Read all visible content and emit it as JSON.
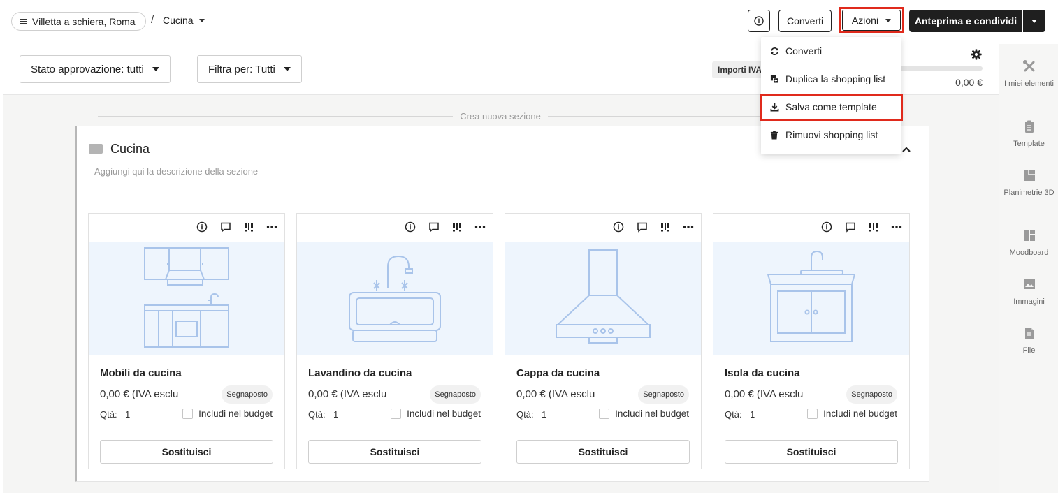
{
  "header": {
    "project": "Villetta a schiera, Roma",
    "separator": "/",
    "room": "Cucina",
    "convert_label": "Converti",
    "actions_label": "Azioni",
    "preview_label": "Anteprima e condividi"
  },
  "filters": {
    "approval": "Stato approvazione: tutti",
    "filter_by": "Filtra per: Tutti",
    "amounts_chip": "Importi IVA",
    "total": "0,00 €"
  },
  "section": {
    "new_section": "Crea nuova sezione",
    "title": "Cucina",
    "description": "Aggiungi qui la descrizione della sezione"
  },
  "products": [
    {
      "name": "Mobili da cucina",
      "price": "0,00 € (IVA esclu",
      "badge": "Segnaposto",
      "qty_label": "Qtà:",
      "qty": "1",
      "budget_label": "Includi nel budget",
      "replace_label": "Sostituisci",
      "icon": "kitchen-furniture-illustration"
    },
    {
      "name": "Lavandino da cucina",
      "price": "0,00 € (IVA esclu",
      "badge": "Segnaposto",
      "qty_label": "Qtà:",
      "qty": "1",
      "budget_label": "Includi nel budget",
      "replace_label": "Sostituisci",
      "icon": "kitchen-sink-illustration"
    },
    {
      "name": "Cappa da cucina",
      "price": "0,00 € (IVA esclu",
      "badge": "Segnaposto",
      "qty_label": "Qtà:",
      "qty": "1",
      "budget_label": "Includi nel budget",
      "replace_label": "Sostituisci",
      "icon": "range-hood-illustration"
    },
    {
      "name": "Isola da cucina",
      "price": "0,00 € (IVA esclu",
      "badge": "Segnaposto",
      "qty_label": "Qtà:",
      "qty": "1",
      "budget_label": "Includi nel budget",
      "replace_label": "Sostituisci",
      "icon": "kitchen-island-illustration"
    }
  ],
  "menu": {
    "items": [
      {
        "label": "Converti",
        "icon": "refresh-icon"
      },
      {
        "label": "Duplica la shopping list",
        "icon": "duplicate-icon"
      },
      {
        "label": "Salva come template",
        "icon": "download-icon",
        "highlighted": true
      },
      {
        "label": "Rimuovi shopping list",
        "icon": "trash-icon"
      }
    ]
  },
  "rail": {
    "items": [
      {
        "label": "I miei elementi",
        "icon": "tools-icon"
      },
      {
        "label": "Template",
        "icon": "clipboard-icon"
      },
      {
        "label": "Planimetrie 3D",
        "icon": "floorplan-icon"
      },
      {
        "label": "Moodboard",
        "icon": "moodboard-icon"
      },
      {
        "label": "Immagini",
        "icon": "image-icon"
      },
      {
        "label": "File",
        "icon": "file-icon"
      }
    ]
  },
  "colors": {
    "highlight": "#e02a1c",
    "primary_dark": "#1f1f1f",
    "image_bg": "#eef5fd",
    "illustration": "#a9c4ea"
  }
}
